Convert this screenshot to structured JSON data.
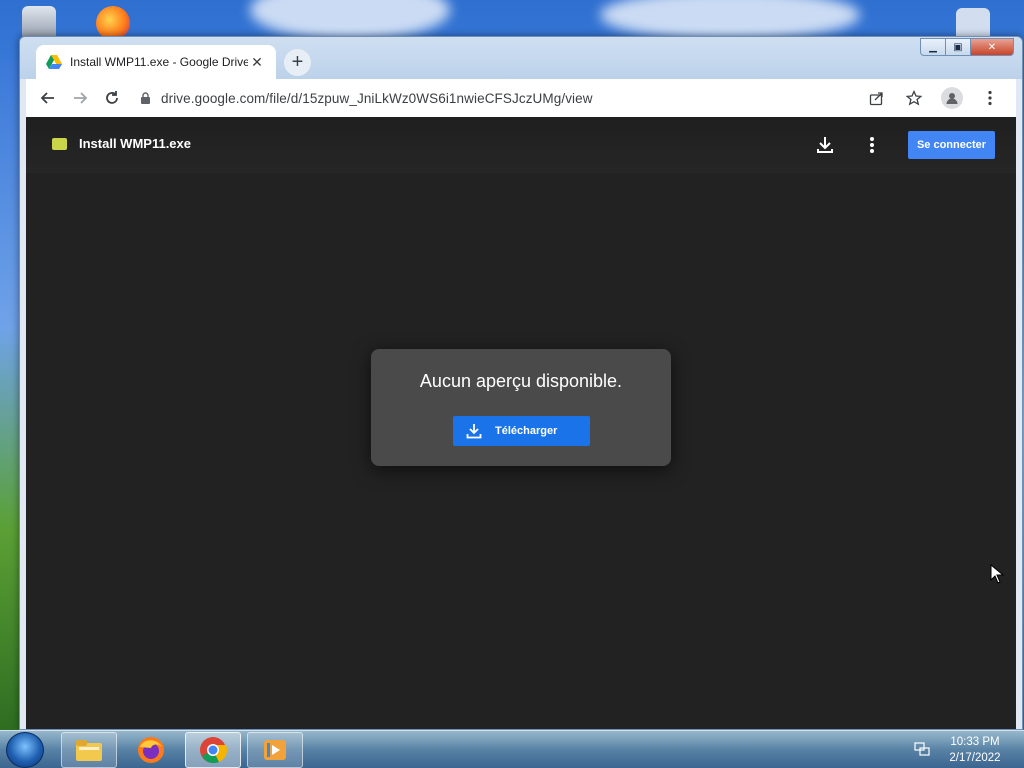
{
  "browser": {
    "tab_title": "Install WMP11.exe - Google Drive",
    "url": "drive.google.com/file/d/15zpuw_JniLkWz0WS6i1nwieCFSJczUMg/view"
  },
  "drive": {
    "file_name": "Install WMP11.exe",
    "signin_label": "Se connecter",
    "no_preview_message": "Aucun aperçu disponible.",
    "download_label": "Télécharger"
  },
  "taskbar": {
    "items": [
      "windows-explorer",
      "firefox",
      "chrome",
      "media-player"
    ],
    "clock_time": "10:33 PM",
    "clock_date": "2/17/2022"
  },
  "colors": {
    "viewer_bg": "#222222",
    "primary_button": "#1a73e8",
    "signin_button": "#4285f4"
  }
}
